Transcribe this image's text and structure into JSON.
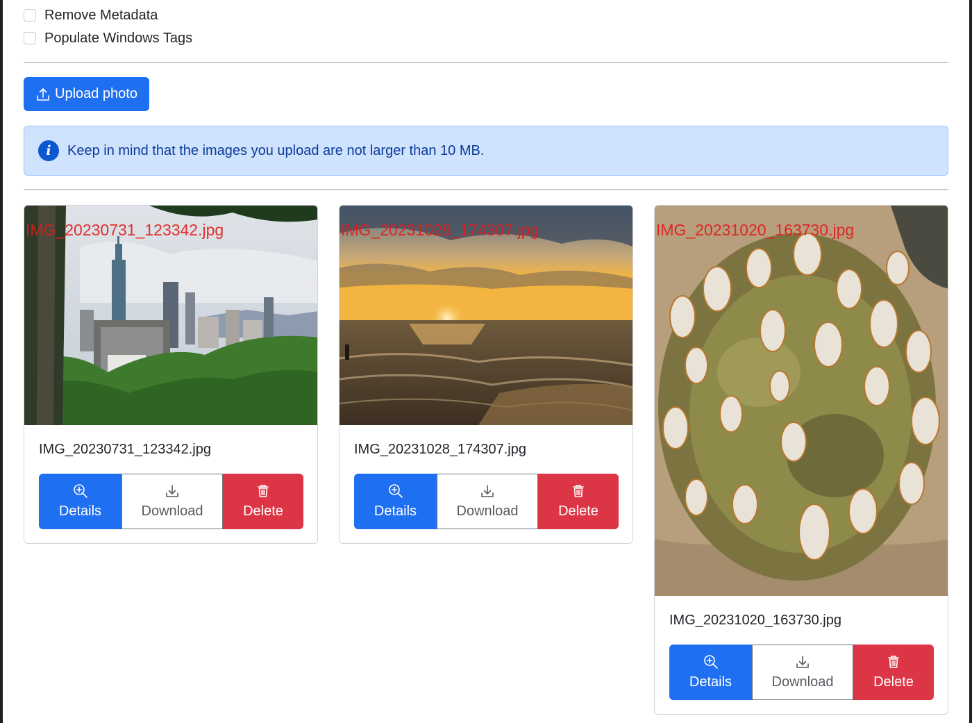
{
  "options": [
    {
      "label": "Remove Metadata",
      "checked": false
    },
    {
      "label": "Populate Windows Tags",
      "checked": false
    }
  ],
  "upload": {
    "label": "Upload photo"
  },
  "alert": {
    "message": "Keep in mind that the images you upload are not larger than 10 MB."
  },
  "buttons": {
    "details": "Details",
    "download": "Download",
    "delete": "Delete"
  },
  "photos": [
    {
      "filename": "IMG_20230731_123342.jpg",
      "watermark": "IMG_20230731_123342.jpg",
      "scene": "city-skyline"
    },
    {
      "filename": "IMG_20231028_174307.jpg",
      "watermark": "IMG_20231028_174307.jpg",
      "scene": "sunset-beach"
    },
    {
      "filename": "IMG_20231020_163730.jpg",
      "watermark": "IMG_20231020_163730.jpg",
      "scene": "barnacles"
    }
  ],
  "colors": {
    "primary": "#1f6ff1",
    "danger": "#dc3545",
    "alert_bg": "#cfe2fe",
    "alert_text": "#0a3a9a"
  }
}
